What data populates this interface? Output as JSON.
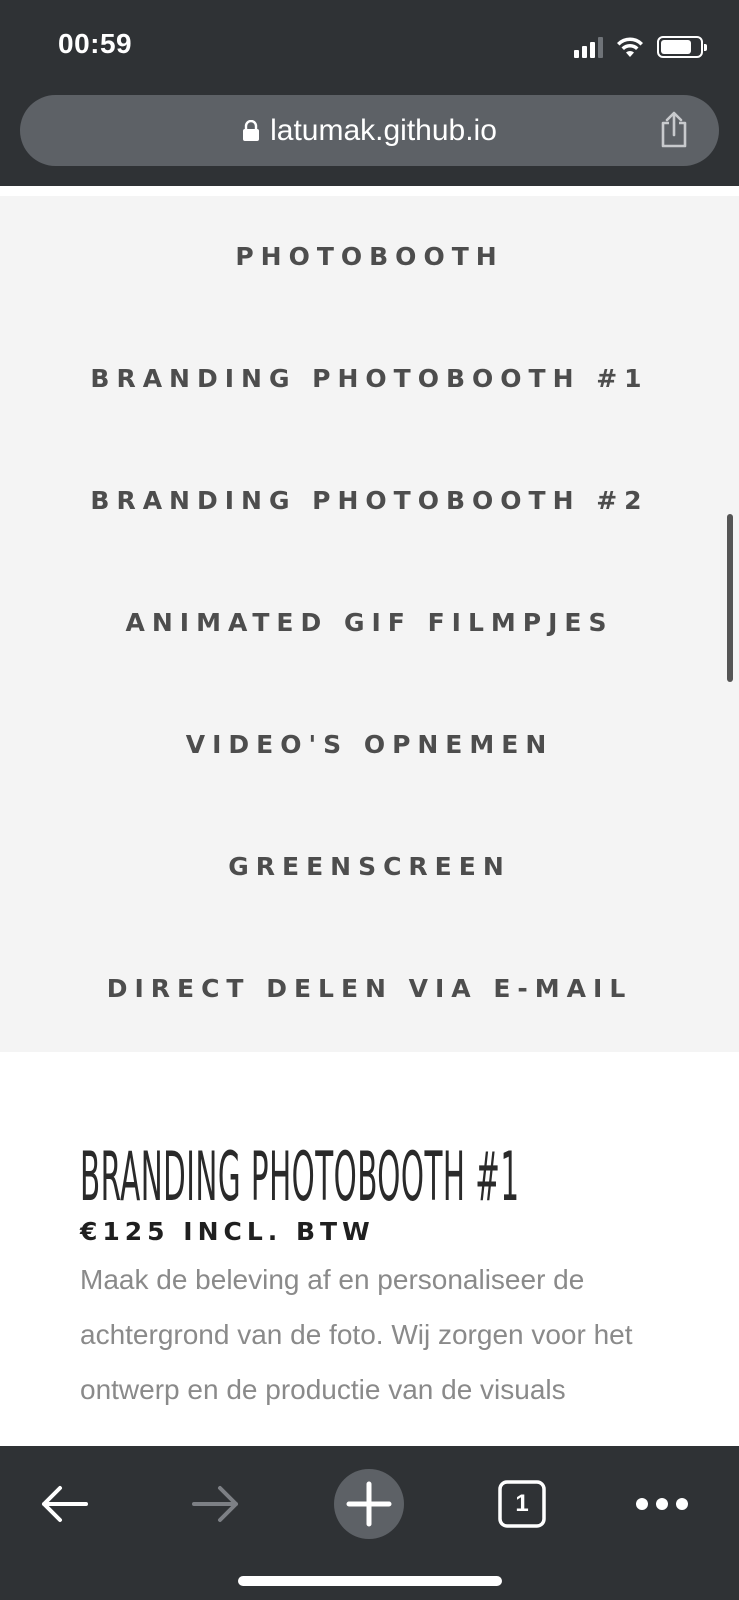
{
  "status_bar": {
    "time": "00:59"
  },
  "browser": {
    "url": "latumak.github.io"
  },
  "menu": {
    "items": [
      "PHOTOBOOTH",
      "BRANDING PHOTOBOOTH #1",
      "BRANDING PHOTOBOOTH #2",
      "ANIMATED GIF FILMPJES",
      "VIDEO'S OPNEMEN",
      "GREENSCREEN",
      "DIRECT DELEN VIA E-MAIL"
    ]
  },
  "section": {
    "title": "BRANDING PHOTOBOOTH #1",
    "price": "€125 INCL. BTW",
    "description": "Maak de beleving af en personaliseer de achtergrond van de foto. Wij zorgen voor het ontwerp en de productie van de visuals"
  },
  "toolbar": {
    "tab_count": "1"
  },
  "icons": {
    "signal": "cellular-signal-icon",
    "wifi": "wifi-icon",
    "battery": "battery-icon",
    "lock": "lock-icon",
    "share": "share-icon",
    "back": "back-arrow-icon",
    "forward": "forward-arrow-icon",
    "new_tab": "plus-icon",
    "tabs": "tabs-icon",
    "more": "more-icon"
  }
}
